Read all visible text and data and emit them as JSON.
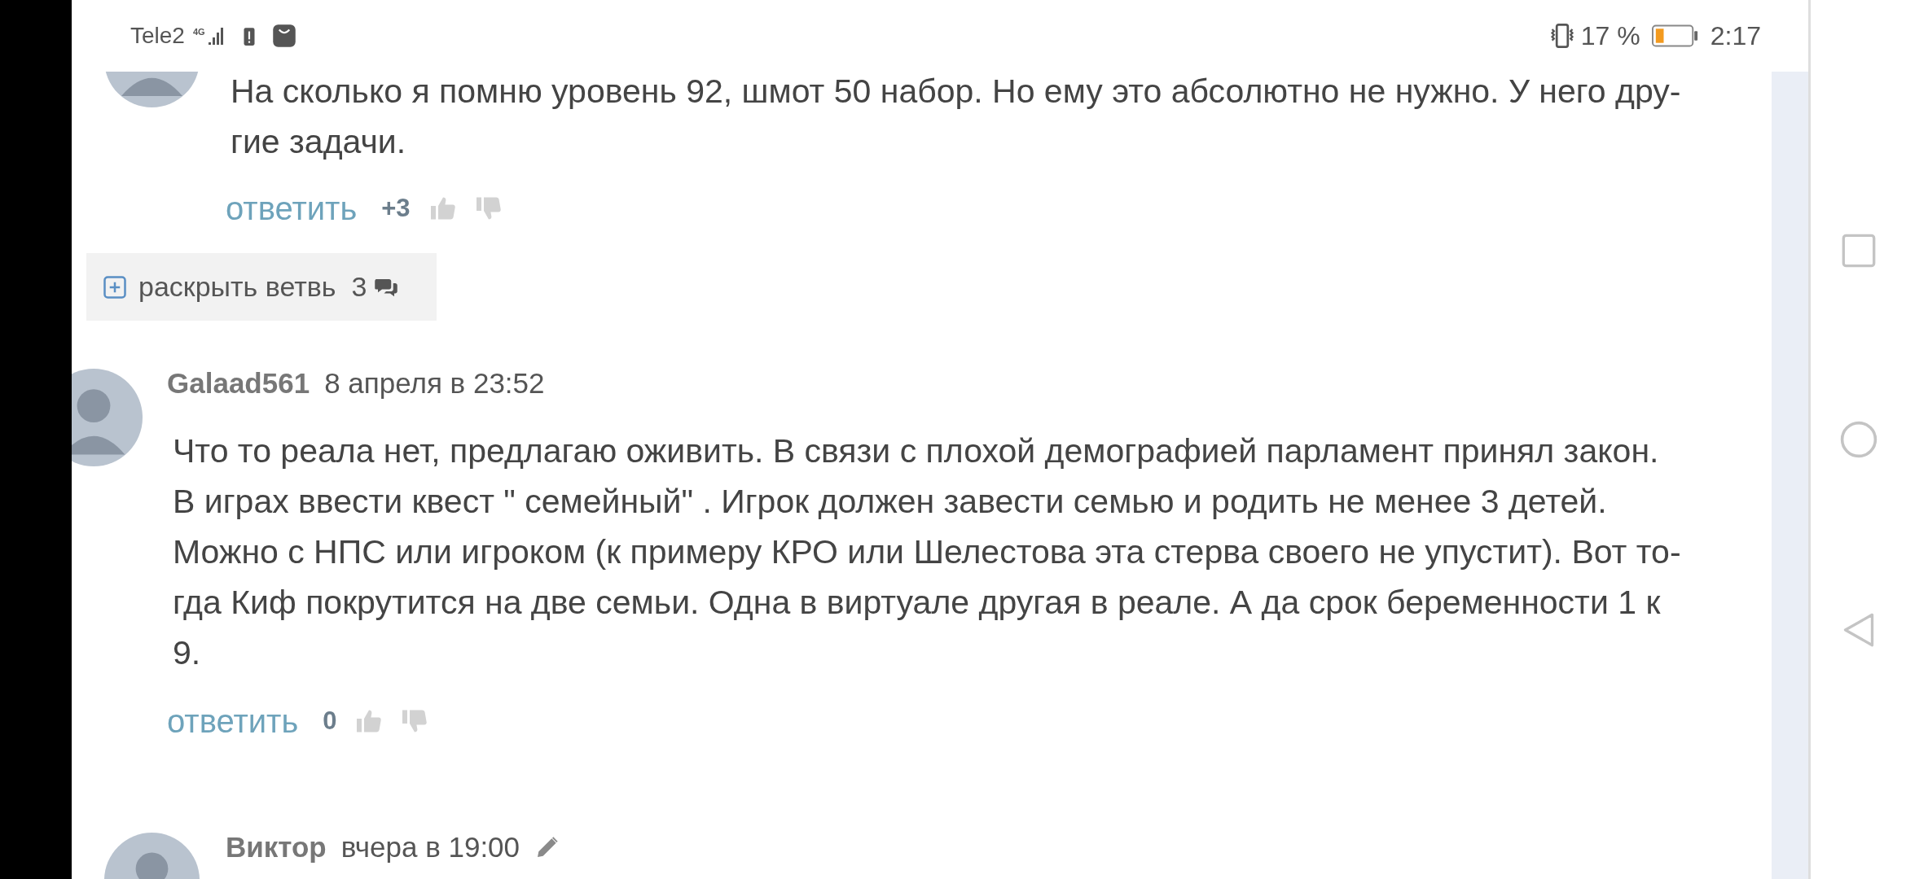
{
  "status_bar": {
    "carrier": "Tele2",
    "network": "4G",
    "battery": "17 %",
    "time": "2:17"
  },
  "thread": [
    {
      "kind": "comment",
      "lines": [
        "На сколько я помню уровень 92, шмот 50 набор. Но ему это абсолютно не нужно. У него дру-",
        "гие задачи."
      ],
      "reply": "ответить",
      "score": "+3"
    },
    {
      "kind": "branch",
      "label": "раскрыть ветвь",
      "count": "3"
    },
    {
      "kind": "comment",
      "author": "Galaad561",
      "date": "8 апреля в 23:52",
      "edited": false,
      "lines": [
        "Что то реала нет, предлагаю оживить. В связи с плохой демографией парламент принял закон.",
        "В играх ввести квест \" семейный\" . Игрок должен завести семью и родить не менее 3 детей.",
        "Можно с НПС или игроком (к примеру КРО или Шелестова эта стерва своего не упустит). Вот то-",
        "гда Киф покрутится на две семьи. Одна в виртуале другая в реале. А да срок беременности 1 к",
        "9."
      ],
      "reply": "ответить",
      "score": "0"
    },
    {
      "kind": "comment",
      "author": "Виктор",
      "date": "вчера в 19:00",
      "edited": true
    }
  ]
}
